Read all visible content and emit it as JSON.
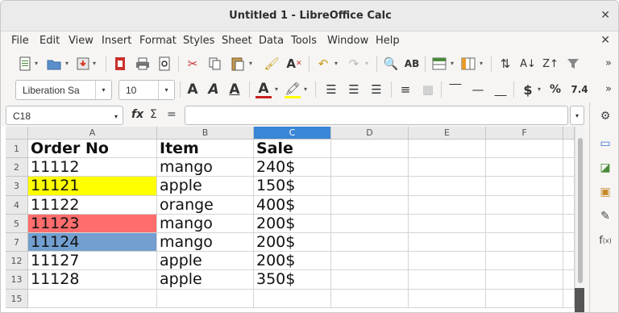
{
  "window": {
    "title": "Untitled 1 - LibreOffice Calc",
    "close_glyph": "✕"
  },
  "menu": {
    "items": [
      "File",
      "Edit",
      "View",
      "Insert",
      "Format",
      "Styles",
      "Sheet",
      "Data",
      "Tools",
      "Window",
      "Help"
    ],
    "close_glyph": "✕"
  },
  "toolbar2": {
    "font_name": "Liberation Sa",
    "font_size": "10",
    "number_format_label": "7.4",
    "currency_symbol": "$",
    "percent_symbol": "%"
  },
  "formula_bar": {
    "name_box": "C18",
    "fx": "fx",
    "sigma": "Σ",
    "equals": "=",
    "value": ""
  },
  "sheet": {
    "columns": [
      "A",
      "B",
      "C",
      "D",
      "E",
      "F"
    ],
    "selected_column": "C",
    "rows": [
      {
        "num": "1",
        "cells": [
          "Order No",
          "Item",
          "Sale"
        ],
        "bold": true,
        "fill": ""
      },
      {
        "num": "2",
        "cells": [
          "11112",
          "mango",
          "240$"
        ],
        "bold": false,
        "fill": ""
      },
      {
        "num": "3",
        "cells": [
          "11121",
          "apple",
          "150$"
        ],
        "bold": false,
        "fill": "#ffff00"
      },
      {
        "num": "4",
        "cells": [
          "11122",
          "orange",
          "400$"
        ],
        "bold": false,
        "fill": ""
      },
      {
        "num": "5",
        "cells": [
          "11123",
          "mango",
          "200$"
        ],
        "bold": false,
        "fill": "#ff6d6d"
      },
      {
        "num": "7",
        "cells": [
          "11124",
          "mango",
          "200$"
        ],
        "bold": false,
        "fill": "#729fcf"
      },
      {
        "num": "12",
        "cells": [
          "11127",
          "apple",
          "200$"
        ],
        "bold": false,
        "fill": ""
      },
      {
        "num": "13",
        "cells": [
          "11128",
          "apple",
          "350$"
        ],
        "bold": false,
        "fill": ""
      },
      {
        "num": "15",
        "cells": [
          "",
          "",
          ""
        ],
        "bold": false,
        "fill": ""
      }
    ]
  },
  "colors": {
    "selected_header": "#3a86d6",
    "yellow_fill": "#ffff00",
    "red_fill": "#ff6d6d",
    "blue_fill": "#729fcf"
  },
  "sidebar": {
    "icons": [
      "gear-icon",
      "properties-icon",
      "styles-icon",
      "gallery-icon",
      "navigator-icon",
      "functions-icon"
    ]
  }
}
